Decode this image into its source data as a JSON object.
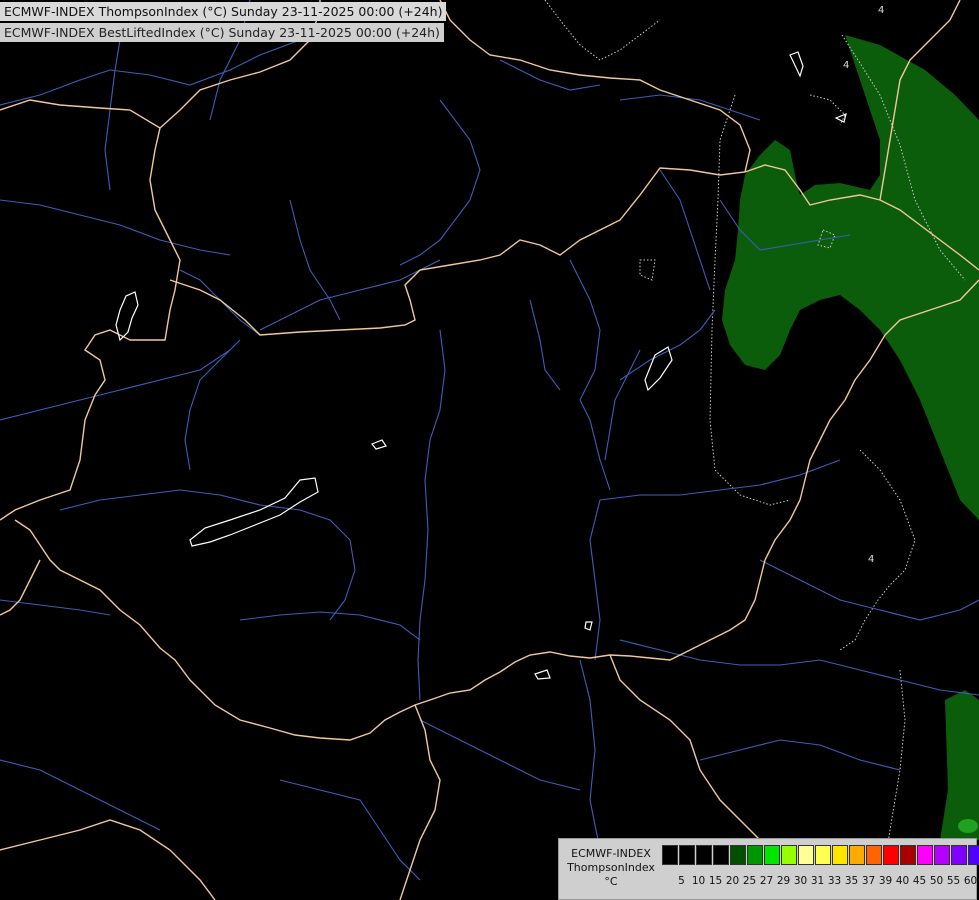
{
  "header": {
    "title_line1": "ECMWF-INDEX ThompsonIndex (°C) Sunday 23-11-2025 00:00 (+24h)",
    "title_line2": "ECMWF-INDEX BestLiftedIndex (°C) Sunday 23-11-2025 00:00 (+24h)"
  },
  "map": {
    "background_color": "#000000",
    "border_color": "#f2c89a",
    "river_color": "#3b5fb8",
    "lake_outline_color": "#ffffff",
    "shaded_field_color": "#0b5c0b",
    "bright_spot_color": "#1fa31f",
    "contour_labels": [
      "4",
      "4",
      "4"
    ]
  },
  "legend": {
    "label_line1": "ECMWF-INDEX",
    "label_line2": "ThompsonIndex",
    "label_line3": "°C",
    "colors": [
      "#000000",
      "#000000",
      "#000000",
      "#000000",
      "#005000",
      "#009600",
      "#00e600",
      "#96ff00",
      "#ffff96",
      "#ffff50",
      "#ffe600",
      "#ffaa00",
      "#ff6400",
      "#ff0000",
      "#aa0000",
      "#ff00ff",
      "#b400ff",
      "#8200ff",
      "#5000ff",
      "#0000ff"
    ],
    "ticks": [
      "5",
      "10",
      "15",
      "20",
      "25",
      "27",
      "29",
      "30",
      "31",
      "33",
      "35",
      "37",
      "39",
      "40",
      "45",
      "50",
      "55",
      "60"
    ]
  }
}
